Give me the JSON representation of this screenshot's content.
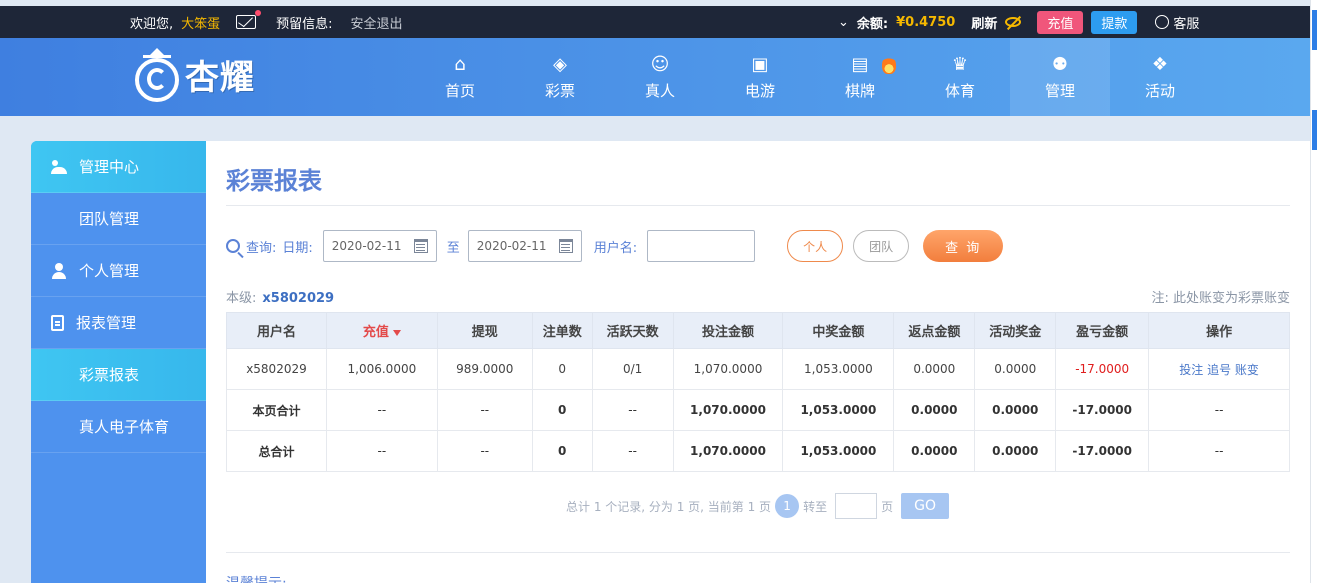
{
  "topbar": {
    "welcome": "欢迎您,",
    "username": "大笨蛋",
    "reserve_info": "预留信息:",
    "logout": "安全退出",
    "balance_label": "余额:",
    "balance_value": "¥0.4750",
    "refresh": "刷新",
    "recharge": "充值",
    "withdraw": "提款",
    "service": "客服"
  },
  "logo": {
    "text": "杏耀"
  },
  "nav": [
    {
      "label": "首页",
      "icon": "home-icon"
    },
    {
      "label": "彩票",
      "icon": "ticket-icon"
    },
    {
      "label": "真人",
      "icon": "dealer-icon"
    },
    {
      "label": "电游",
      "icon": "slot-icon"
    },
    {
      "label": "棋牌",
      "icon": "cards-icon"
    },
    {
      "label": "体育",
      "icon": "trophy-icon"
    },
    {
      "label": "管理",
      "icon": "users-icon"
    },
    {
      "label": "活动",
      "icon": "gift-icon"
    }
  ],
  "sidebar": {
    "management_center": "管理中心",
    "team_management": "团队管理",
    "personal_management": "个人管理",
    "report_management": "报表管理",
    "lottery_report": "彩票报表",
    "live_esports": "真人电子体育"
  },
  "main": {
    "title": "彩票报表",
    "query_label": "查询:",
    "date_label": "日期:",
    "date_from": "2020-02-11",
    "date_to": "2020-02-11",
    "to_label": "至",
    "username_label": "用户名:",
    "personal": "个人",
    "team": "团队",
    "query_button": "查 询",
    "level_label": "本级:",
    "level_user": "x5802029",
    "note": "注: 此处账变为彩票账变"
  },
  "table": {
    "headers": [
      "用户名",
      "充值",
      "提现",
      "注单数",
      "活跃天数",
      "投注金额",
      "中奖金额",
      "返点金额",
      "活动奖金",
      "盈亏金额",
      "操作"
    ],
    "row": [
      "x5802029",
      "1,006.0000",
      "989.0000",
      "0",
      "0/1",
      "1,070.0000",
      "1,053.0000",
      "0.0000",
      "0.0000",
      "-17.0000",
      "投注 追号 账变"
    ],
    "page_total": [
      "本页合计",
      "--",
      "--",
      "0",
      "--",
      "1,070.0000",
      "1,053.0000",
      "0.0000",
      "0.0000",
      "-17.0000",
      "--"
    ],
    "grand_total": [
      "总合计",
      "--",
      "--",
      "0",
      "--",
      "1,070.0000",
      "1,053.0000",
      "0.0000",
      "0.0000",
      "-17.0000",
      "--"
    ]
  },
  "pager": {
    "summary": "总计 1 个记录, 分为 1 页, 当前第 1 页",
    "current_page": "1",
    "jump_label": "转至",
    "page_unit": "页",
    "go": "GO"
  },
  "tips": "温馨提示:",
  "colors": {
    "accent": "#5b82d6",
    "sidebar": "#4e92ee",
    "negative": "#e01e1e",
    "orange": "#f27e3d"
  }
}
